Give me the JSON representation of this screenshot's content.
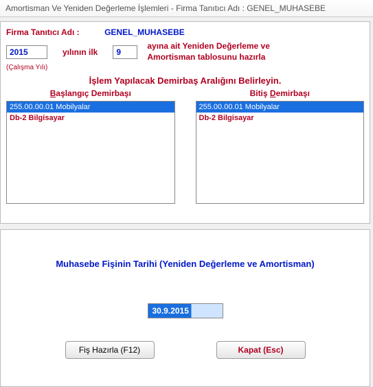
{
  "title_bar": "Amortisman Ve Yeniden Değerleme İşlemleri - Firma Tanıtıcı Adı : GENEL_MUHASEBE",
  "firm": {
    "label": "Firma Tanıtıcı Adı :",
    "name": "GENEL_MUHASEBE"
  },
  "year": "2015",
  "year_label_mid": "yılının ilk",
  "month": "9",
  "desc_line1": "ayına ait Yeniden Değerleme  ve",
  "desc_line2": "Amortisman tablosunu hazırla",
  "working_year_label": "(Çalışma Yılı)",
  "section_title": "İşlem Yapılacak Demirbaş Aralığını Belirleyin.",
  "start_label_u": "B",
  "start_label_rest": "aşlangıç Demirbaşı",
  "end_label_pre": "Bitiş ",
  "end_label_u": "D",
  "end_label_post": "emirbaşı",
  "list_start": [
    {
      "text": "255.00.00.01 Mobilyalar",
      "selected": true
    },
    {
      "text": "Db-2 Bilgisayar",
      "selected": false
    }
  ],
  "list_end": [
    {
      "text": "255.00.00.01 Mobilyalar",
      "selected": true
    },
    {
      "text": "Db-2 Bilgisayar",
      "selected": false
    }
  ],
  "muh_title": "Muhasebe Fişinin Tarihi (Yeniden Değerleme ve Amortisman)",
  "date_value": "30.9.2015",
  "btn_prepare": "Fiş Hazırla (F12)",
  "btn_close": "Kapat (Esc)"
}
